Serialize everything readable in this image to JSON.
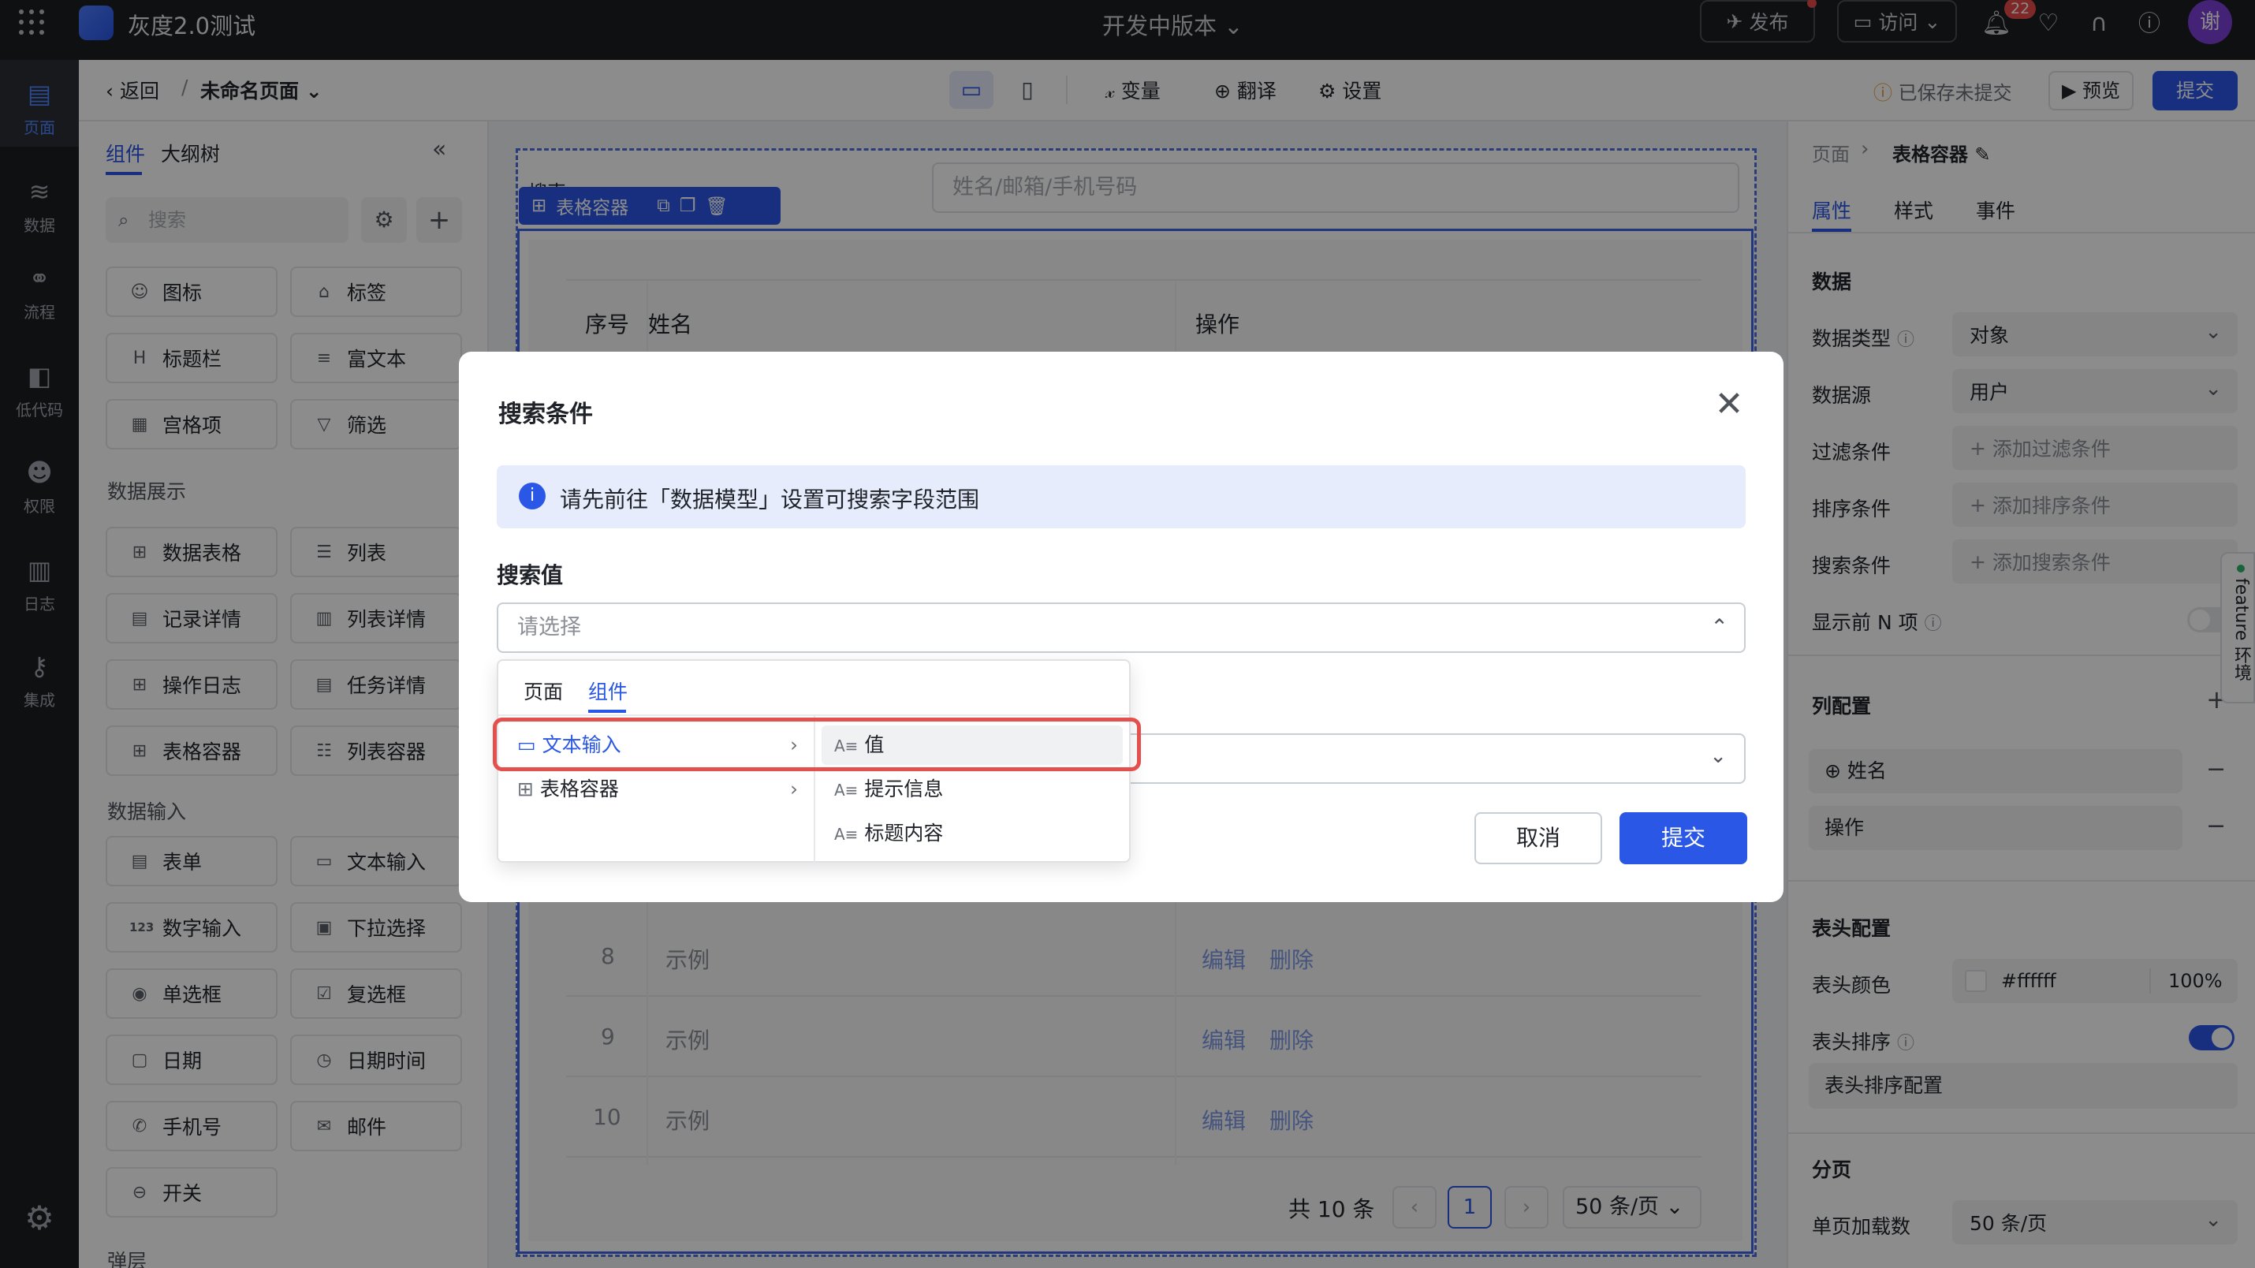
{
  "topbar": {
    "app_title": "灰度2.0测试",
    "version": "开发中版本",
    "publish": "发布",
    "visit": "访问",
    "notifications": "22",
    "user_initial": "谢"
  },
  "leftnav": {
    "items": [
      {
        "label": "页面",
        "icon": "page-icon"
      },
      {
        "label": "数据",
        "icon": "database-icon"
      },
      {
        "label": "流程",
        "icon": "flow-icon"
      },
      {
        "label": "低代码",
        "icon": "code-icon"
      },
      {
        "label": "权限",
        "icon": "users-icon"
      },
      {
        "label": "日志",
        "icon": "log-icon"
      },
      {
        "label": "集成",
        "icon": "key-icon"
      }
    ]
  },
  "subbar": {
    "back": "返回",
    "page_name": "未命名页面",
    "variables": "变量",
    "translate": "翻译",
    "settings": "设置",
    "save_status": "已保存未提交",
    "preview": "预览",
    "submit": "提交"
  },
  "leftpanel": {
    "tabs": [
      "组件",
      "大纲树"
    ],
    "search_placeholder": "搜索",
    "basic": [
      {
        "label": "图标",
        "icon": "☺"
      },
      {
        "label": "标签",
        "icon": "⌂"
      },
      {
        "label": "标题栏",
        "icon": "H"
      },
      {
        "label": "富文本",
        "icon": "≡"
      },
      {
        "label": "宫格项",
        "icon": "▦"
      },
      {
        "label": "筛选",
        "icon": "▽"
      }
    ],
    "section_display": "数据展示",
    "display": [
      {
        "label": "数据表格",
        "icon": "⊞"
      },
      {
        "label": "列表",
        "icon": "☰"
      },
      {
        "label": "记录详情",
        "icon": "▤"
      },
      {
        "label": "列表详情",
        "icon": "▥"
      },
      {
        "label": "操作日志",
        "icon": "⊞"
      },
      {
        "label": "任务详情",
        "icon": "▤"
      },
      {
        "label": "表格容器",
        "icon": "⊞"
      },
      {
        "label": "列表容器",
        "icon": "☷"
      }
    ],
    "section_input": "数据输入",
    "input": [
      {
        "label": "表单",
        "icon": "▤"
      },
      {
        "label": "文本输入",
        "icon": "▭"
      },
      {
        "label": "数字输入",
        "icon": "123"
      },
      {
        "label": "下拉选择",
        "icon": "▣"
      },
      {
        "label": "单选框",
        "icon": "◉"
      },
      {
        "label": "复选框",
        "icon": "☑"
      },
      {
        "label": "日期",
        "icon": "▢"
      },
      {
        "label": "日期时间",
        "icon": "◷"
      },
      {
        "label": "手机号",
        "icon": "✆"
      },
      {
        "label": "邮件",
        "icon": "✉"
      },
      {
        "label": "开关",
        "icon": "⊖"
      }
    ],
    "section_popup": "弹层"
  },
  "canvas": {
    "search_label": "搜索",
    "toolbar_label": "表格容器",
    "search_placeholder": "姓名/邮箱/手机号码",
    "columns": [
      "序号",
      "姓名",
      "操作"
    ],
    "rows": [
      {
        "no": "8",
        "name": "示例",
        "edit": "编辑",
        "delete": "删除"
      },
      {
        "no": "9",
        "name": "示例",
        "edit": "编辑",
        "delete": "删除"
      },
      {
        "no": "10",
        "name": "示例",
        "edit": "编辑",
        "delete": "删除"
      }
    ],
    "total": "共 10 条",
    "page": "1",
    "page_size": "50 条/页"
  },
  "rightpanel": {
    "breadcrumb_root": "页面",
    "breadcrumb_current": "表格容器",
    "tabs": [
      "属性",
      "样式",
      "事件"
    ],
    "section_data": "数据",
    "data_type_label": "数据类型",
    "data_type_value": "对象",
    "data_source_label": "数据源",
    "data_source_value": "用户",
    "filter_label": "过滤条件",
    "filter_add": "添加过滤条件",
    "sort_label": "排序条件",
    "sort_add": "添加排序条件",
    "search_label": "搜索条件",
    "search_add": "添加搜索条件",
    "show_n_label": "显示前 N 项",
    "section_columns": "列配置",
    "columns": [
      "姓名",
      "操作"
    ],
    "section_header": "表头配置",
    "header_color_label": "表头颜色",
    "header_color_value": "#ffffff",
    "header_opacity": "100%",
    "header_sort_label": "表头排序",
    "header_sort_config": "表头排序配置",
    "section_pagination": "分页",
    "page_load_label": "单页加载数",
    "page_load_value": "50 条/页",
    "feature_tab": "feature 环境"
  },
  "dialog": {
    "title": "搜索条件",
    "info": "请先前往「数据模型」设置可搜索字段范围",
    "field_label": "搜索值",
    "placeholder": "请选择",
    "cancel": "取消",
    "submit": "提交",
    "dropdown": {
      "tabs": [
        "页面",
        "组件"
      ],
      "left": [
        "文本输入",
        "表格容器"
      ],
      "right": [
        "值",
        "提示信息",
        "标题内容"
      ]
    }
  }
}
